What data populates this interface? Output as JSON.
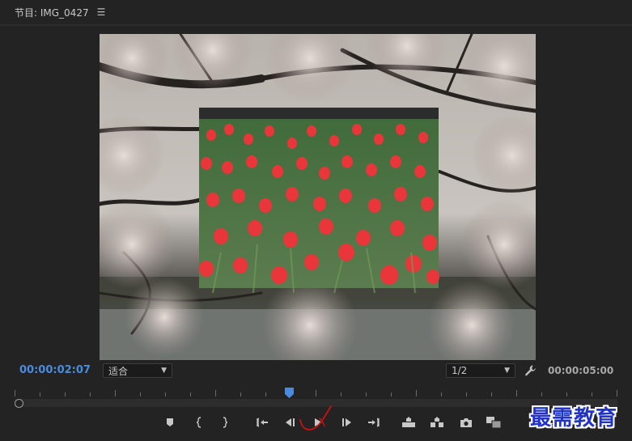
{
  "panel": {
    "title": "节目: IMG_0427",
    "menu_icon": "hamburger-menu-icon"
  },
  "monitor": {
    "background_image": "cherry-blossom-tree-over-pond",
    "overlay_image": "red-tulip-field"
  },
  "timecodes": {
    "current": "00:00:02:07",
    "duration": "00:00:05:00"
  },
  "controls": {
    "fit_select": "适合",
    "resolution_select": "1/2",
    "settings_icon": "wrench-icon"
  },
  "transport": {
    "buttons": [
      {
        "name": "add-marker-button",
        "icon": "marker-icon"
      },
      {
        "name": "mark-in-button",
        "icon": "mark-in-icon"
      },
      {
        "name": "mark-out-button",
        "icon": "mark-out-icon"
      },
      {
        "name": "go-to-in-button",
        "icon": "go-to-in-icon"
      },
      {
        "name": "step-back-button",
        "icon": "step-back-icon"
      },
      {
        "name": "play-button",
        "icon": "play-icon"
      },
      {
        "name": "step-forward-button",
        "icon": "step-forward-icon"
      },
      {
        "name": "go-to-out-button",
        "icon": "go-to-out-icon"
      },
      {
        "name": "lift-button",
        "icon": "lift-icon"
      },
      {
        "name": "extract-button",
        "icon": "extract-icon"
      },
      {
        "name": "export-frame-button",
        "icon": "camera-icon"
      },
      {
        "name": "compare-view-button",
        "icon": "compare-icon"
      }
    ]
  },
  "colors": {
    "accent": "#4a8be0",
    "panel_bg": "#232323",
    "annotation": "#cc1111",
    "watermark": "#2233cc"
  },
  "watermark": {
    "text": "最需教育"
  }
}
